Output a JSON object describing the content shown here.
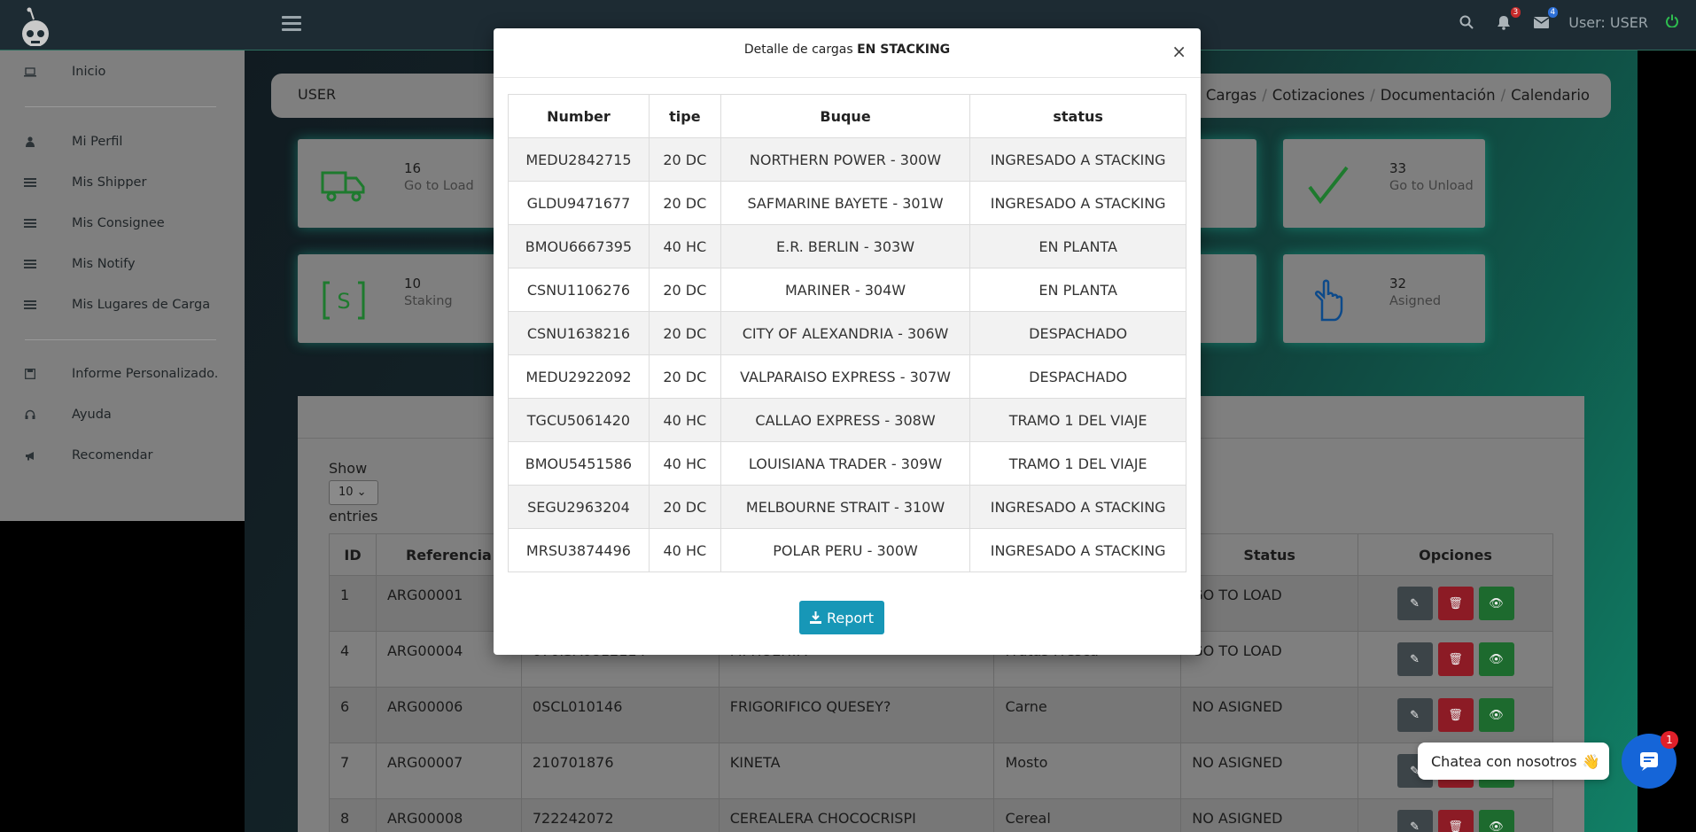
{
  "topbar": {
    "user_label": "User: USER",
    "notifications_count": "3",
    "messages_count": "4"
  },
  "sidebar": {
    "items": [
      {
        "label": "Inicio",
        "icon": "laptop-icon"
      },
      {
        "label": "Mi Perfil",
        "icon": "user-icon"
      },
      {
        "label": "Mis Shipper",
        "icon": "list-icon"
      },
      {
        "label": "Mis Consignee",
        "icon": "list-icon"
      },
      {
        "label": "Mis Notify",
        "icon": "list-icon"
      },
      {
        "label": "Mis Lugares de Carga",
        "icon": "list-icon"
      },
      {
        "label": "Informe Personalizado.",
        "icon": "save-icon"
      },
      {
        "label": "Ayuda",
        "icon": "headset-icon"
      },
      {
        "label": "Recomendar",
        "icon": "megaphone-icon"
      }
    ]
  },
  "breadcrumb": {
    "user": "USER",
    "links": [
      "Mis Cargas",
      "Cotizaciones",
      "Documentación",
      "Calendario"
    ]
  },
  "stats": [
    {
      "num": "16",
      "label": "Go to Load"
    },
    {
      "num": "33",
      "label": "Go to Unload"
    },
    {
      "num": "10",
      "label": "Staking"
    },
    {
      "num": "32",
      "label": "Asigned"
    }
  ],
  "list": {
    "show_label": "Show",
    "page_size": "10",
    "entries_label": "entries",
    "headers": [
      "ID",
      "Referencia",
      "",
      "",
      "",
      "Status",
      "Opciones"
    ],
    "rows": [
      {
        "id": "1",
        "ref": "ARG00001",
        "booking": "",
        "client": "",
        "product": "",
        "status": "GO TO LOAD"
      },
      {
        "id": "4",
        "ref": "ARG00004",
        "booking": "070ISA0812114",
        "client": "MI HUERTA",
        "product": "Frutas Fresca",
        "status": "GO TO LOAD"
      },
      {
        "id": "6",
        "ref": "ARG00006",
        "booking": "0SCL010146",
        "client": "FRIGORIFICO QUESEY?",
        "product": "Carne",
        "status": "NO ASIGNED"
      },
      {
        "id": "7",
        "ref": "ARG00007",
        "booking": "210701876",
        "client": "KINETA",
        "product": "Mosto",
        "status": "NO ASIGNED"
      },
      {
        "id": "8",
        "ref": "ARG00008",
        "booking": "722242072",
        "client": "CEREALERA CHOCOCRISPI",
        "product": "Cereal",
        "status": "NO ASIGNED"
      }
    ]
  },
  "modal": {
    "title_prefix": "Detalle de cargas",
    "title_bold": "EN STACKING",
    "close": "×",
    "headers": [
      "Number",
      "tipe",
      "Buque",
      "status"
    ],
    "rows": [
      {
        "number": "MEDU2842715",
        "tipe": "20 DC",
        "buque": "NORTHERN POWER - 300W",
        "status": "INGRESADO A STACKING"
      },
      {
        "number": "GLDU9471677",
        "tipe": "20 DC",
        "buque": "SAFMARINE BAYETE - 301W",
        "status": "INGRESADO A STACKING"
      },
      {
        "number": "BMOU6667395",
        "tipe": "40 HC",
        "buque": "E.R. BERLIN - 303W",
        "status": "EN PLANTA"
      },
      {
        "number": "CSNU1106276",
        "tipe": "20 DC",
        "buque": "MARINER - 304W",
        "status": "EN PLANTA"
      },
      {
        "number": "CSNU1638216",
        "tipe": "20 DC",
        "buque": "CITY OF ALEXANDRIA - 306W",
        "status": "DESPACHADO"
      },
      {
        "number": "MEDU2922092",
        "tipe": "20 DC",
        "buque": "VALPARAISO EXPRESS - 307W",
        "status": "DESPACHADO"
      },
      {
        "number": "TGCU5061420",
        "tipe": "40 HC",
        "buque": "CALLAO EXPRESS - 308W",
        "status": "TRAMO 1 DEL VIAJE"
      },
      {
        "number": "BMOU5451586",
        "tipe": "40 HC",
        "buque": "LOUISIANA TRADER - 309W",
        "status": "TRAMO 1 DEL VIAJE"
      },
      {
        "number": "SEGU2963204",
        "tipe": "20 DC",
        "buque": "MELBOURNE STRAIT - 310W",
        "status": "INGRESADO A STACKING"
      },
      {
        "number": "MRSU3874496",
        "tipe": "40 HC",
        "buque": "POLAR PERU - 300W",
        "status": "INGRESADO A STACKING"
      }
    ],
    "report_label": "Report"
  },
  "chat": {
    "bubble_text": "Chatea con nosotros",
    "badge": "1"
  },
  "colors": {
    "accent": "#1797b7",
    "sidebar_bg": "#7f7f7f",
    "topbar_bg": "#1d2b33",
    "chat_blue": "#1565d8"
  }
}
